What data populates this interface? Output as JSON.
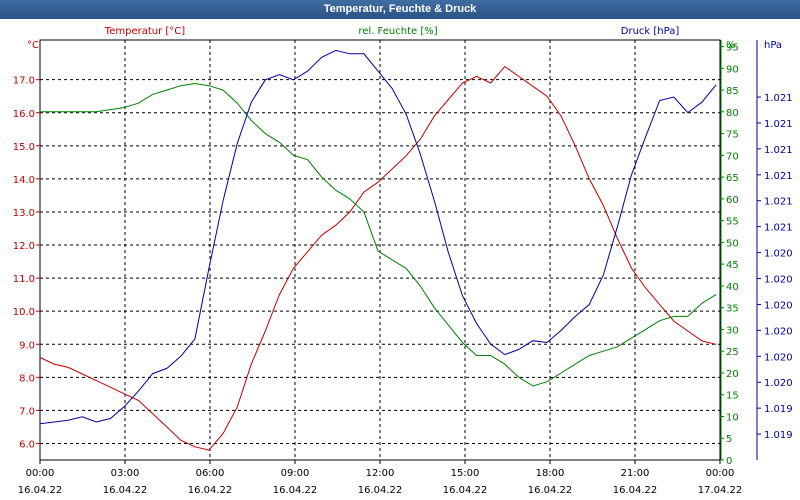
{
  "window": {
    "title": "Temperatur, Feuchte & Druck"
  },
  "chart_data": {
    "type": "line",
    "title": "Temperatur, Feuchte & Druck",
    "x": [
      "00:00",
      "00:30",
      "01:00",
      "01:30",
      "02:00",
      "02:30",
      "03:00",
      "03:30",
      "04:00",
      "04:30",
      "05:00",
      "05:30",
      "06:00",
      "06:30",
      "07:00",
      "07:30",
      "08:00",
      "08:30",
      "09:00",
      "09:30",
      "10:00",
      "10:30",
      "11:00",
      "11:30",
      "12:00",
      "12:30",
      "13:00",
      "13:30",
      "14:00",
      "14:30",
      "15:00",
      "15:30",
      "16:00",
      "16:30",
      "17:00",
      "17:30",
      "18:00",
      "18:30",
      "19:00",
      "19:30",
      "20:00",
      "20:30",
      "21:00",
      "21:30",
      "22:00",
      "22:30",
      "23:00",
      "23:30",
      "23:55"
    ],
    "x_ticks": [
      {
        "time": "00:00",
        "date": "16.04.22"
      },
      {
        "time": "03:00",
        "date": "16.04.22"
      },
      {
        "time": "06:00",
        "date": "16.04.22"
      },
      {
        "time": "09:00",
        "date": "16.04.22"
      },
      {
        "time": "12:00",
        "date": "16.04.22"
      },
      {
        "time": "15:00",
        "date": "16.04.22"
      },
      {
        "time": "18:00",
        "date": "16.04.22"
      },
      {
        "time": "21:00",
        "date": "16.04.22"
      },
      {
        "time": "00:00",
        "date": "17.04.22"
      }
    ],
    "series": [
      {
        "name": "Temperatur [°C]",
        "axis": "left",
        "color": "#c00000",
        "values": [
          8.6,
          8.4,
          8.3,
          8.1,
          7.9,
          7.7,
          7.5,
          7.3,
          6.9,
          6.5,
          6.1,
          5.9,
          5.8,
          6.3,
          7.1,
          8.4,
          9.4,
          10.5,
          11.3,
          11.8,
          12.3,
          12.6,
          13.0,
          13.6,
          13.9,
          14.3,
          14.7,
          15.2,
          15.9,
          16.4,
          16.9,
          17.1,
          16.9,
          17.4,
          17.1,
          16.8,
          16.5,
          15.9,
          15.0,
          14.0,
          13.2,
          12.2,
          11.3,
          10.7,
          10.2,
          9.7,
          9.4,
          9.1,
          9.0
        ]
      },
      {
        "name": "rel. Feuchte [%]",
        "axis": "right1",
        "color": "#008000",
        "values": [
          80,
          80,
          80,
          80,
          80,
          80.5,
          81,
          82,
          84,
          85,
          86,
          86.5,
          86,
          85,
          82,
          78,
          75,
          73,
          70,
          69,
          65,
          62,
          60,
          57,
          48,
          46,
          44,
          40,
          35,
          31,
          27,
          24,
          24,
          22,
          19,
          17,
          18,
          20,
          22,
          24,
          25,
          26,
          28,
          30,
          32,
          33,
          33,
          36,
          38
        ]
      },
      {
        "name": "Druck [hPa]",
        "axis": "right2",
        "color": "#0000a0",
        "values": [
          1019.06,
          1019.07,
          1019.08,
          1019.1,
          1019.07,
          1019.09,
          1019.16,
          1019.25,
          1019.35,
          1019.38,
          1019.45,
          1019.55,
          1019.96,
          1020.35,
          1020.68,
          1020.92,
          1021.05,
          1021.08,
          1021.05,
          1021.1,
          1021.18,
          1021.22,
          1021.2,
          1021.2,
          1021.1,
          1021.0,
          1020.85,
          1020.62,
          1020.35,
          1020.05,
          1019.8,
          1019.64,
          1019.52,
          1019.46,
          1019.49,
          1019.54,
          1019.53,
          1019.6,
          1019.68,
          1019.75,
          1019.92,
          1020.2,
          1020.5,
          1020.72,
          1020.93,
          1020.95,
          1020.86,
          1020.92,
          1021.02
        ]
      }
    ],
    "axes": {
      "left": {
        "label": "°C",
        "min": 5.5,
        "max": 18.2,
        "ticks": [
          "6.0",
          "7.0",
          "8.0",
          "9.0",
          "10.0",
          "11.0",
          "12.0",
          "13.0",
          "14.0",
          "15.0",
          "16.0",
          "17.0"
        ],
        "tick_values": [
          6,
          7,
          8,
          9,
          10,
          11,
          12,
          13,
          14,
          15,
          16,
          17
        ]
      },
      "right1": {
        "label": "%",
        "min": 0,
        "max": 96.5,
        "ticks": [
          "0",
          "5",
          "10",
          "15",
          "20",
          "25",
          "30",
          "35",
          "40",
          "45",
          "50",
          "55",
          "60",
          "65",
          "70",
          "75",
          "80",
          "85",
          "90",
          "95"
        ],
        "tick_values": [
          0,
          5,
          10,
          15,
          20,
          25,
          30,
          35,
          40,
          45,
          50,
          55,
          60,
          65,
          70,
          75,
          80,
          85,
          90,
          95
        ]
      },
      "right2": {
        "label": "hPa",
        "min": 1018.85,
        "max": 1021.28,
        "ticks": [
          "1.019",
          "1.019",
          "1.020",
          "1.020",
          "1.020",
          "1.020",
          "1.020",
          "1.020",
          "1.021",
          "1.021",
          "1.021",
          "1.021",
          "1.021",
          "1.021"
        ],
        "tick_values": [
          1019.0,
          1019.15,
          1019.3,
          1019.45,
          1019.6,
          1019.75,
          1019.9,
          1020.05,
          1020.2,
          1020.35,
          1020.5,
          1020.65,
          1020.8,
          1020.95
        ]
      }
    },
    "grid": true,
    "grid_style": "dashed"
  }
}
